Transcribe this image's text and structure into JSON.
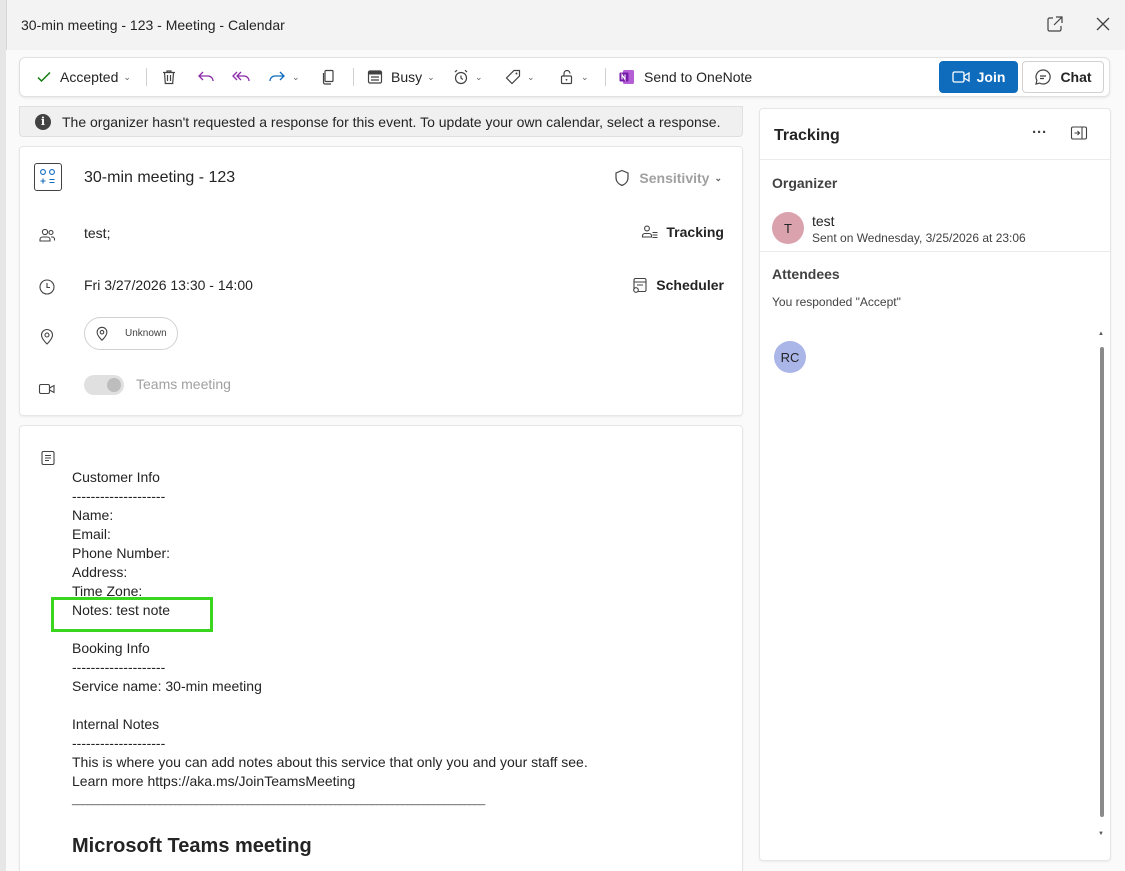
{
  "window": {
    "title": "30-min meeting - 123 - Meeting - Calendar"
  },
  "toolbar": {
    "accepted_label": "Accepted",
    "busy_label": "Busy",
    "onenote_label": "Send to OneNote",
    "join_label": "Join",
    "chat_label": "Chat"
  },
  "infobar": {
    "icon_glyph": "i",
    "message": "The organizer hasn't requested a response for this event. To update your own calendar, select a response."
  },
  "details": {
    "meeting_title": "30-min meeting - 123",
    "sensitivity_label": "Sensitivity",
    "attendees": "test;",
    "tracking_label": "Tracking",
    "datetime": "Fri 3/27/2026 13:30 - 14:00",
    "scheduler_label": "Scheduler",
    "location": "Unknown",
    "teams_label": "Teams meeting"
  },
  "body": {
    "lines": [
      "Customer Info",
      "--------------------",
      "Name:",
      "Email:",
      "Phone Number:",
      "Address:",
      "Time Zone:",
      "Notes: test note",
      "",
      "Booking Info",
      "--------------------",
      "Service name: 30-min meeting",
      "",
      "Internal Notes",
      "--------------------",
      "This is where you can add notes about this service that only you and your staff see.",
      "Learn more https://aka.ms/JoinTeamsMeeting",
      "________________________________________________________________________________"
    ],
    "teams_heading": "Microsoft Teams meeting"
  },
  "tracking": {
    "title": "Tracking",
    "more_glyph": "···",
    "organizer_label": "Organizer",
    "organizer_initial": "T",
    "organizer_name": "test",
    "organizer_sent": "Sent on Wednesday, 3/25/2026 at 23:06",
    "attendees_label": "Attendees",
    "response_text": "You responded \"Accept\"",
    "attendee_initials": "RC",
    "scroll_up_glyph": "▲",
    "scroll_down_glyph": "▼"
  },
  "colors": {
    "join_blue": "#0f6cbd",
    "highlight_green": "#3ad51e",
    "organizer_avatar": "#d9a2ad",
    "attendee_avatar": "#aab5e8"
  }
}
